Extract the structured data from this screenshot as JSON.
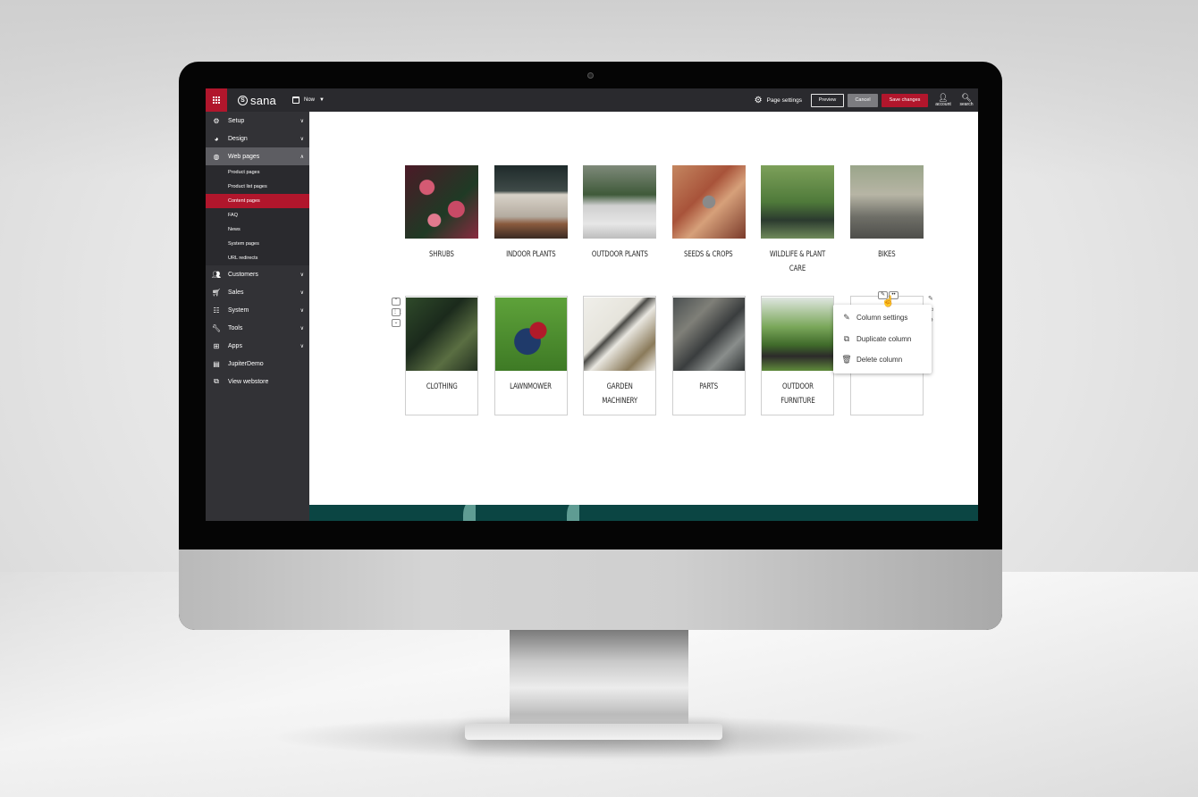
{
  "topbar": {
    "brand": "sana",
    "date_selector": "Now",
    "page_settings_label": "Page settings",
    "preview_label": "Preview",
    "cancel_label": "Cancel",
    "save_label": "Save changes",
    "account_label": "account",
    "search_label": "search"
  },
  "colors": {
    "accent": "#b1162c",
    "topbar": "#2a2a2e",
    "sidebar": "#323236",
    "footer": "#0b4543"
  },
  "sidebar": {
    "items": [
      {
        "label": "Setup",
        "icon": "gear-icon"
      },
      {
        "label": "Design",
        "icon": "palette-icon"
      },
      {
        "label": "Web pages",
        "icon": "globe-icon",
        "expanded": true
      },
      {
        "label": "Customers",
        "icon": "users-icon"
      },
      {
        "label": "Sales",
        "icon": "cart-icon"
      },
      {
        "label": "System",
        "icon": "sliders-icon"
      },
      {
        "label": "Tools",
        "icon": "wrench-icon"
      },
      {
        "label": "Apps",
        "icon": "apps-icon"
      },
      {
        "label": "JupiterDemo",
        "icon": "store-icon"
      },
      {
        "label": "View webstore",
        "icon": "external-link-icon"
      }
    ],
    "web_pages_sub": [
      {
        "label": "Product pages"
      },
      {
        "label": "Product list pages"
      },
      {
        "label": "Content pages",
        "active": true
      },
      {
        "label": "FAQ"
      },
      {
        "label": "News"
      },
      {
        "label": "System pages"
      },
      {
        "label": "URL redirects"
      }
    ]
  },
  "content": {
    "row1": [
      {
        "label": "SHRUBS"
      },
      {
        "label": "INDOOR PLANTS"
      },
      {
        "label": "OUTDOOR PLANTS"
      },
      {
        "label": "SEEDS & CROPS"
      },
      {
        "label": "WILDLIFE & PLANT\nCARE"
      },
      {
        "label": "BIKES"
      }
    ],
    "row2": [
      {
        "label": "CLOTHING"
      },
      {
        "label": "LAWNMOWER"
      },
      {
        "label": "GARDEN\nMACHINERY"
      },
      {
        "label": "PARTS"
      },
      {
        "label": "OUTDOOR\nFURNITURE"
      },
      {
        "label": ""
      }
    ]
  },
  "context_menu": {
    "items": [
      {
        "label": "Column settings",
        "icon": "pencil-icon"
      },
      {
        "label": "Duplicate column",
        "icon": "copy-icon"
      },
      {
        "label": "Delete column",
        "icon": "trash-icon"
      }
    ]
  }
}
